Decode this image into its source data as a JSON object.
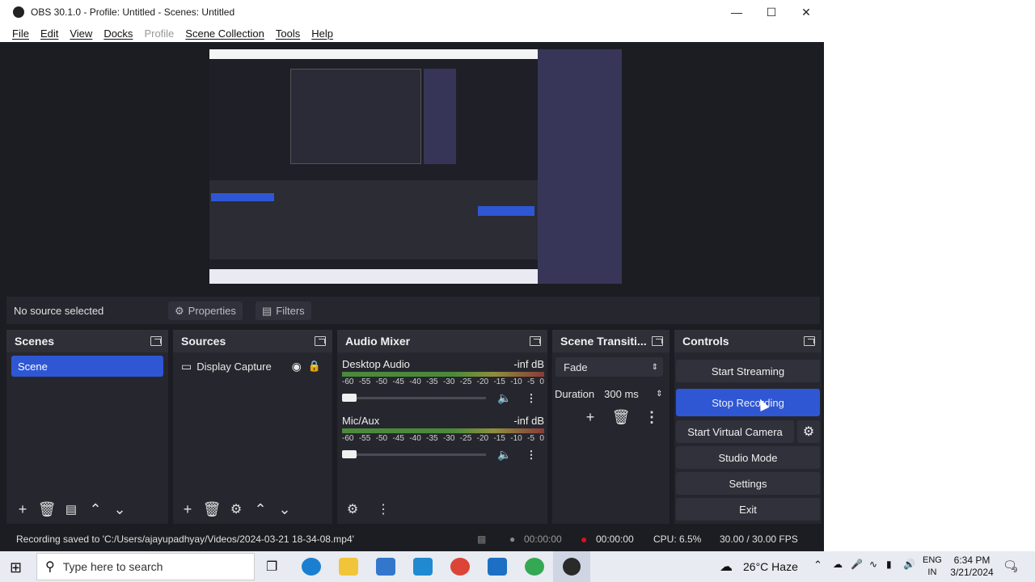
{
  "window": {
    "title": "OBS 30.1.0 - Profile: Untitled - Scenes: Untitled"
  },
  "menu": [
    "File",
    "Edit",
    "View",
    "Docks",
    "Profile",
    "Scene Collection",
    "Tools",
    "Help"
  ],
  "context": {
    "no_source": "No source selected",
    "properties": "Properties",
    "filters": "Filters"
  },
  "docks": {
    "scenes": {
      "title": "Scenes",
      "items": [
        "Scene"
      ]
    },
    "sources": {
      "title": "Sources",
      "items": [
        "Display Capture"
      ]
    },
    "mixer": {
      "title": "Audio Mixer",
      "channels": [
        {
          "name": "Desktop Audio",
          "level": "-inf dB"
        },
        {
          "name": "Mic/Aux",
          "level": "-inf dB"
        }
      ],
      "ticks": [
        "-60",
        "-55",
        "-50",
        "-45",
        "-40",
        "-35",
        "-30",
        "-25",
        "-20",
        "-15",
        "-10",
        "-5",
        "0"
      ]
    },
    "transitions": {
      "title": "Scene Transiti...",
      "selected": "Fade",
      "duration_label": "Duration",
      "duration_value": "300 ms"
    },
    "controls": {
      "title": "Controls",
      "start_streaming": "Start Streaming",
      "stop_recording": "Stop Recording",
      "start_virtual_camera": "Start Virtual Camera",
      "studio_mode": "Studio Mode",
      "settings": "Settings",
      "exit": "Exit"
    }
  },
  "status": {
    "message": "Recording saved to 'C:/Users/ajayupadhyay/Videos/2024-03-21 18-34-08.mp4'",
    "stream_time": "00:00:00",
    "record_time": "00:00:00",
    "cpu": "CPU: 6.5%",
    "fps": "30.00 / 30.00 FPS"
  },
  "taskbar": {
    "search_placeholder": "Type here to search",
    "weather": "26°C  Haze",
    "lang1": "ENG",
    "lang2": "IN",
    "time": "6:34 PM",
    "date": "3/21/2024",
    "notif_count": "9"
  },
  "colors": {
    "accent": "#2f57d4",
    "panel": "#26272e",
    "record": "#d6131e"
  }
}
